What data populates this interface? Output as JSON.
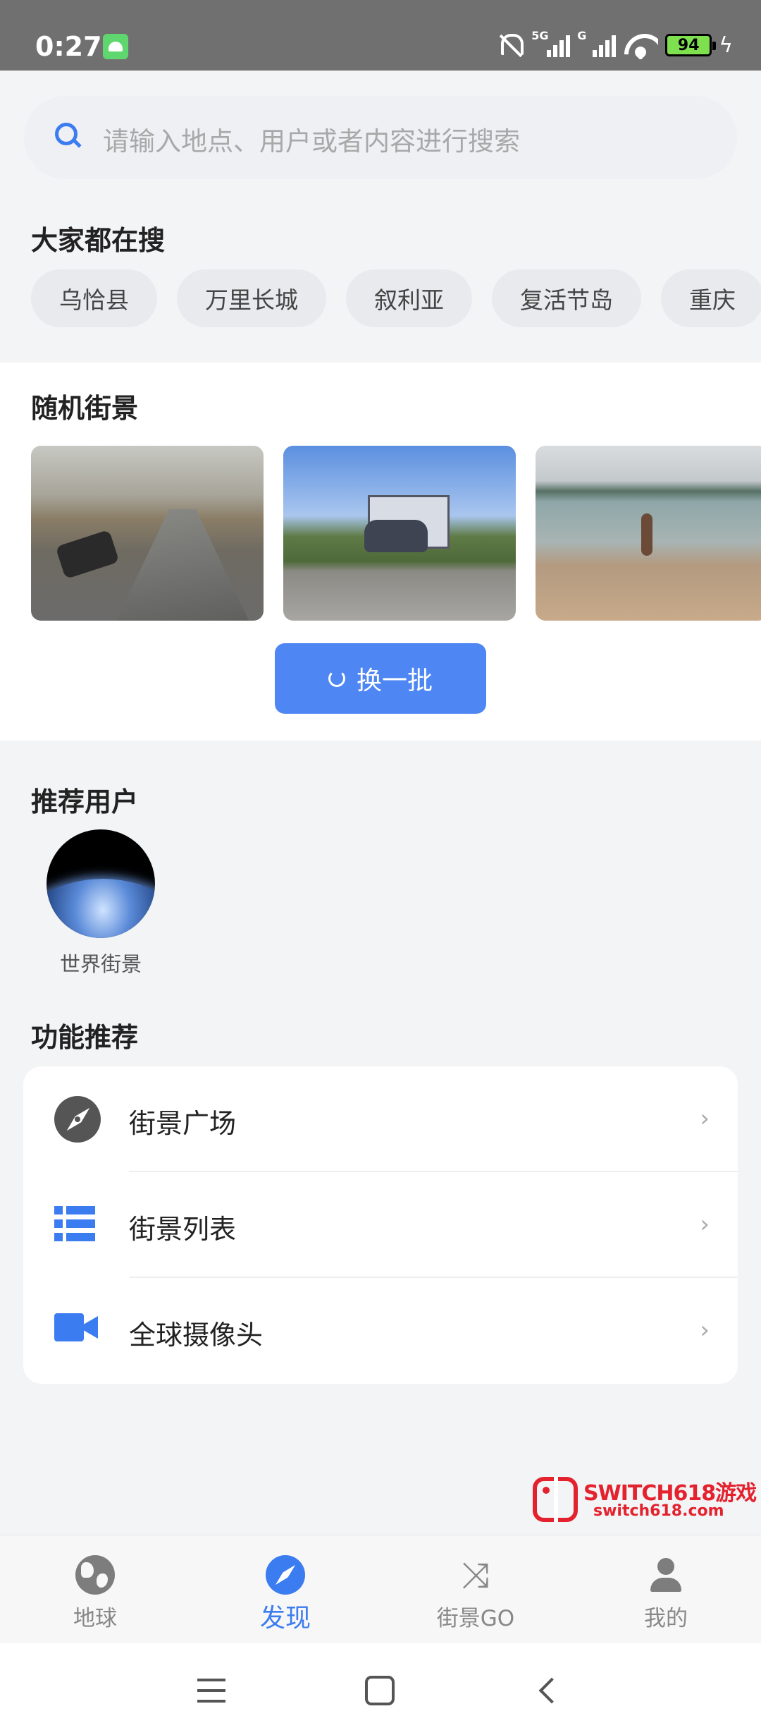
{
  "status_bar": {
    "time": "0:27",
    "network_1": "5G",
    "network_2": "G",
    "battery": "94"
  },
  "search": {
    "placeholder": "请输入地点、用户或者内容进行搜索"
  },
  "hot_searches": {
    "title": "大家都在搜",
    "tags": [
      "乌恰县",
      "万里长城",
      "叙利亚",
      "复活节岛",
      "重庆"
    ]
  },
  "random_street_view": {
    "title": "随机街景",
    "refresh_label": "换一批"
  },
  "recommended_users": {
    "title": "推荐用户",
    "users": [
      {
        "name": "世界街景"
      }
    ]
  },
  "features": {
    "title": "功能推荐",
    "items": [
      {
        "label": "街景广场",
        "icon": "compass-icon"
      },
      {
        "label": "街景列表",
        "icon": "list-icon"
      },
      {
        "label": "全球摄像头",
        "icon": "video-camera-icon"
      }
    ],
    "chevron": "›"
  },
  "watermark": {
    "title": "SWITCH618游戏",
    "url": "switch618.com"
  },
  "tab_bar": {
    "tabs": [
      {
        "label": "地球",
        "icon": "globe-icon",
        "active": false
      },
      {
        "label": "发现",
        "icon": "compass-icon",
        "active": true
      },
      {
        "label": "街景GO",
        "icon": "shuffle-icon",
        "active": false
      },
      {
        "label": "我的",
        "icon": "person-icon",
        "active": false
      }
    ]
  },
  "colors": {
    "accent": "#3b7cf0",
    "button": "#4e86f3",
    "background": "#f3f4f6"
  }
}
